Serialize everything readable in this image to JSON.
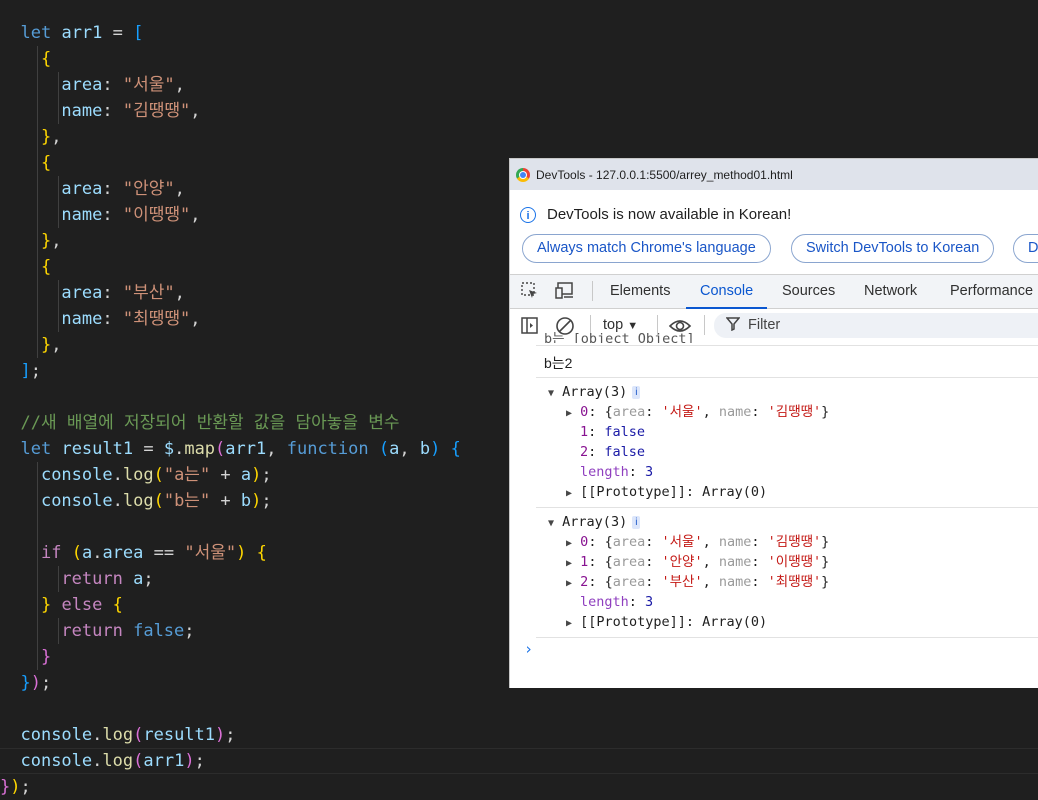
{
  "editor": {
    "comment": "//새 배열에 저장되어 반환할 값을 담아놓을 변수",
    "strings": {
      "area1": "\"서울\"",
      "name1": "\"김땡땡\"",
      "area2": "\"안양\"",
      "name2": "\"이땡땡\"",
      "area3": "\"부산\"",
      "name3": "\"최땡땡\"",
      "log_a": "\"a는\"",
      "log_b": "\"b는\"",
      "cond": "\"서울\""
    }
  },
  "devtools": {
    "title": "DevTools - 127.0.0.1:5500/arrey_method01.html",
    "info_message": "DevTools is now available in Korean!",
    "buttons": [
      "Always match Chrome's language",
      "Switch DevTools to Korean",
      "D"
    ],
    "tabs": [
      "Elements",
      "Console",
      "Sources",
      "Network",
      "Performance"
    ],
    "active_tab": "Console",
    "context": "top",
    "filter_placeholder": "Filter",
    "console": {
      "partial_line": "b는 [object Object]",
      "b_log": "b는2",
      "array1": {
        "header": "Array(3)",
        "items": [
          {
            "index": "0",
            "area": "'서울'",
            "name": "'김땡땡'"
          },
          {
            "index": "1",
            "value": "false"
          },
          {
            "index": "2",
            "value": "false"
          }
        ],
        "length": "3",
        "prototype": "[[Prototype]]: Array(0)"
      },
      "array2": {
        "header": "Array(3)",
        "items": [
          {
            "index": "0",
            "area": "'서울'",
            "name": "'김땡땡'"
          },
          {
            "index": "1",
            "area": "'안양'",
            "name": "'이땡땡'"
          },
          {
            "index": "2",
            "area": "'부산'",
            "name": "'최땡땡'"
          }
        ],
        "length": "3",
        "prototype": "[[Prototype]]: Array(0)"
      },
      "info_badge": "i",
      "prompt": "›"
    }
  }
}
